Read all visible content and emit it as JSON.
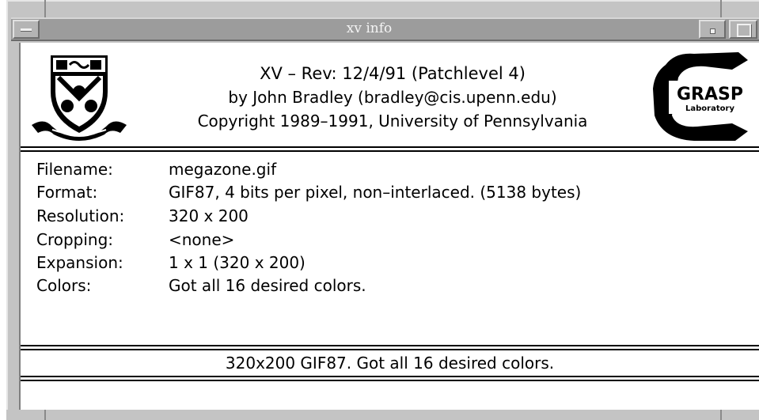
{
  "window": {
    "title": "xv info"
  },
  "header": {
    "line1": "XV  –  Rev: 12/4/91  (Patchlevel 4)",
    "line2": "by John Bradley  (bradley@cis.upenn.edu)",
    "line3": "Copyright 1989–1991, University of Pennsylvania",
    "logo_right_text_big": "GRASP",
    "logo_right_text_small": "Laboratory"
  },
  "info": [
    {
      "label": "Filename:",
      "value": "megazone.gif"
    },
    {
      "label": "Format:",
      "value": "GIF87, 4 bits per pixel, non–interlaced.  (5138 bytes)"
    },
    {
      "label": "Resolution:",
      "value": "320 x 200"
    },
    {
      "label": "Cropping:",
      "value": "<none>"
    },
    {
      "label": "Expansion:",
      "value": "1 x 1  (320 x 200)"
    },
    {
      "label": "Colors:",
      "value": "Got all 16 desired colors."
    }
  ],
  "status": {
    "text": "320x200 GIF87.  Got all 16 desired colors."
  },
  "icons": {
    "window_menu": "window-menu-icon",
    "minimize": "minimize-icon",
    "maximize": "maximize-icon",
    "left_logo": "university-crest-icon",
    "right_logo": "grasp-lab-logo-icon"
  },
  "colors": {
    "titlebar": "#9c9c9c",
    "frame": "#c4c4c4",
    "client": "#ffffff",
    "text": "#000000"
  }
}
